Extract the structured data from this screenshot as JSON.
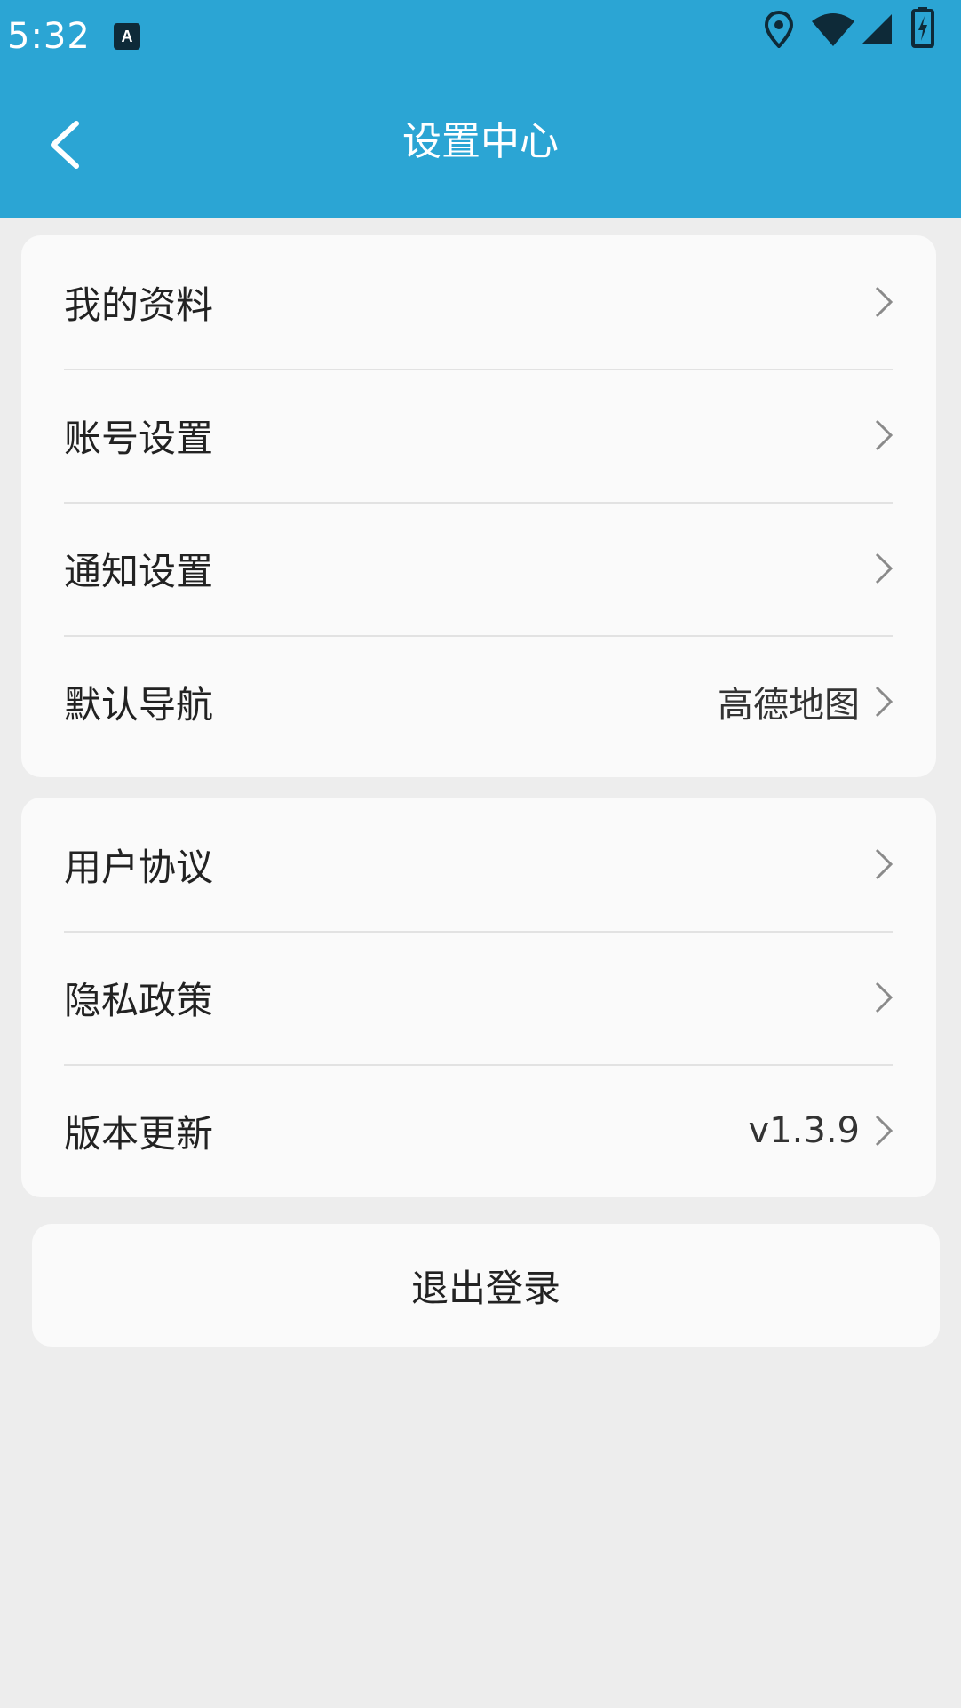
{
  "status_bar": {
    "time": "5:32",
    "icons": [
      "a-notification-icon",
      "location-icon",
      "wifi-icon",
      "signal-icon",
      "battery-charging-icon"
    ]
  },
  "header": {
    "title": "设置中心",
    "back_icon": "back-chevron-icon",
    "bg_color": "#2ba5d4"
  },
  "groups": {
    "personal": [
      {
        "label": "我的资料",
        "value": ""
      },
      {
        "label": "账号设置",
        "value": ""
      },
      {
        "label": "通知设置",
        "value": ""
      },
      {
        "label": "默认导航",
        "value": "高德地图"
      }
    ],
    "about": [
      {
        "label": "用户协议",
        "value": ""
      },
      {
        "label": "隐私政策",
        "value": ""
      },
      {
        "label": "版本更新",
        "value": "v1.3.9"
      }
    ]
  },
  "logout": {
    "label": "退出登录"
  }
}
